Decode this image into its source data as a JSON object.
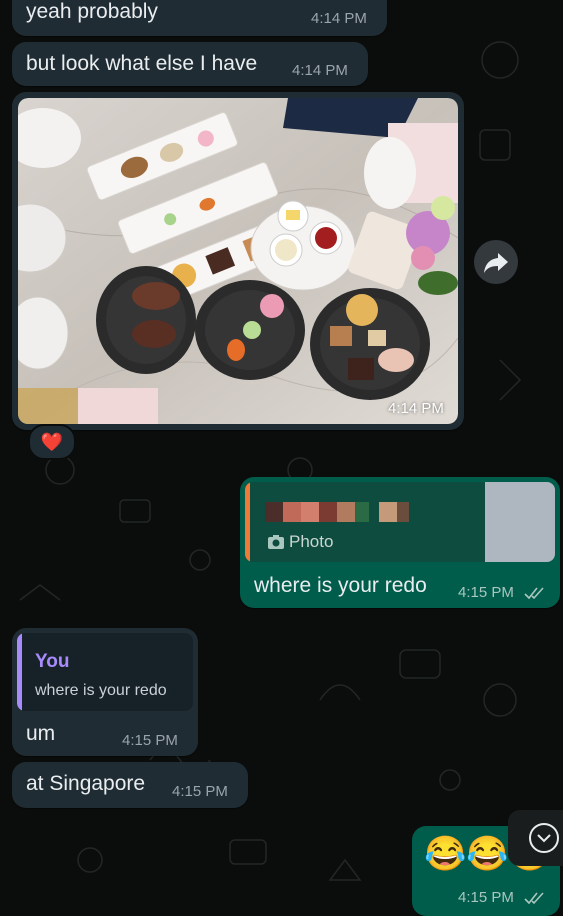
{
  "messages": {
    "m1": {
      "text": "yeah probably",
      "time": "4:14 PM"
    },
    "m2": {
      "text": "but look what else I have",
      "time": "4:14 PM"
    },
    "m3": {
      "type": "photo",
      "time": "4:14 PM",
      "reaction": "❤️"
    },
    "m4": {
      "reply_label": "Photo",
      "text": "where is your redo",
      "time": "4:15 PM"
    },
    "m5": {
      "reply_author": "You",
      "reply_text": "where is your redo",
      "text": "um",
      "time": "4:15 PM"
    },
    "m6": {
      "text": "at Singapore",
      "time": "4:15 PM"
    },
    "m7": {
      "emojis": "😂😂😂",
      "time": "4:15 PM"
    }
  },
  "colors": {
    "incoming_bubble": "#1f2c33",
    "outgoing_bubble": "#005c4b",
    "reply_accent_you": "#a78bfa",
    "reply_accent_photo": "#ef7a37",
    "read_ticks": "#a9c7bf"
  },
  "icons": {
    "forward": "forward-arrow-icon",
    "scroll_down": "chevron-down-icon",
    "camera": "camera-icon",
    "read_receipt": "double-check-icon"
  }
}
